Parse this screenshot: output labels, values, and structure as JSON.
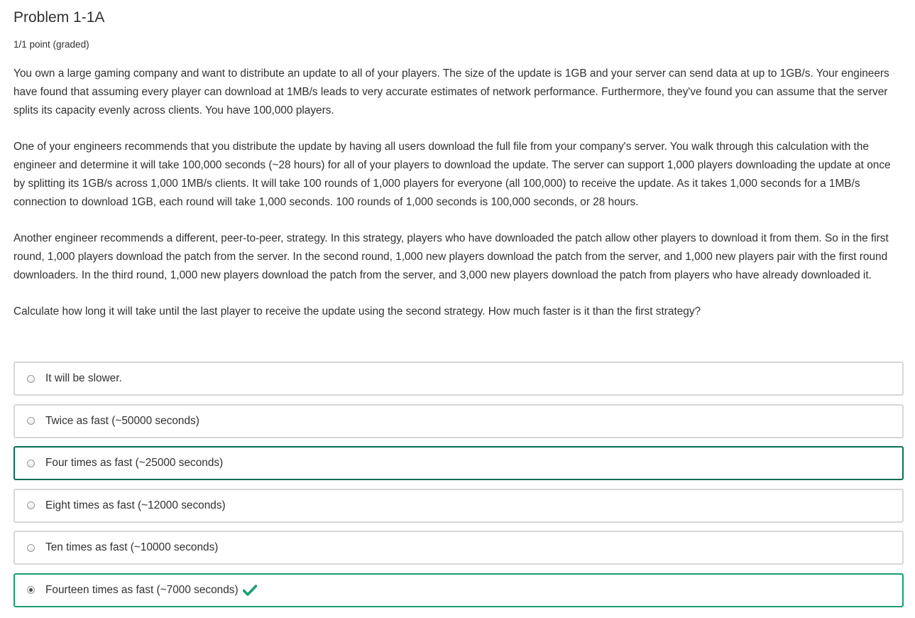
{
  "problem": {
    "title": "Problem 1-1A",
    "progress": "1/1 point (graded)",
    "paragraphs": [
      "You own a large gaming company and want to distribute an update to all of your players. The size of the update is 1GB and your server can send data at up to 1GB/s. Your engineers have found that assuming every player can download at 1MB/s leads to very accurate estimates of network performance. Furthermore, they've found you can assume that the server splits its capacity evenly across clients. You have 100,000 players.",
      "One of your engineers recommends that you distribute the update by having all users download the full file from your company's server. You walk through this calculation with the engineer and determine it will take 100,000 seconds (~28 hours) for all of your players to download the update. The server can support 1,000 players downloading the update at once by splitting its 1GB/s across 1,000 1MB/s clients. It will take 100 rounds of 1,000 players for everyone (all 100,000) to receive the update. As it takes 1,000 seconds for a 1MB/s connection to download 1GB, each round will take 1,000 seconds. 100 rounds of 1,000 seconds is 100,000 seconds, or 28 hours.",
      "Another engineer recommends a different, peer-to-peer, strategy. In this strategy, players who have downloaded the patch allow other players to download it from them. So in the first round, 1,000 players download the patch from the server. In the second round, 1,000 new players download the patch from the server, and 1,000 new players pair with the first round downloaders. In the third round, 1,000 new players download the patch from the server, and 3,000 new players download the patch from players who have already downloaded it."
    ],
    "question": "Calculate how long it will take until the last player to receive the update using the second strategy. How much faster is it than the first strategy?",
    "choices": [
      {
        "label": "It will be slower."
      },
      {
        "label": "Twice as fast (~50000 seconds)"
      },
      {
        "label": "Four times as fast (~25000 seconds)"
      },
      {
        "label": "Eight times as fast (~12000 seconds)"
      },
      {
        "label": "Ten times as fast (~10000 seconds)"
      },
      {
        "label": "Fourteen times as fast (~7000 seconds)"
      }
    ],
    "selected_index": 5,
    "focused_index": 2,
    "correct_icon": "checkmark-icon"
  },
  "colors": {
    "text": "#313131",
    "focus_border": "#0b6e56",
    "correct_border": "#1a9e6e",
    "checkmark": "#1a9e6e",
    "default_border": "#d7d7d7"
  }
}
